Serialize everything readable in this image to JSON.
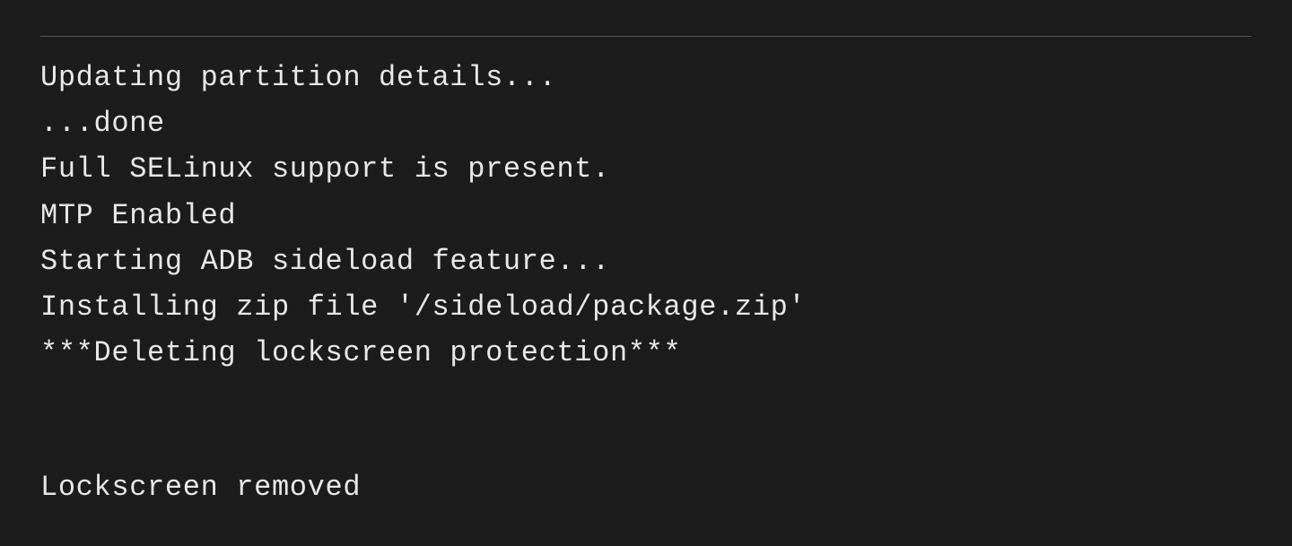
{
  "terminal": {
    "divider": true,
    "lines": [
      {
        "id": "line1",
        "text": "Updating partition details...",
        "empty": false
      },
      {
        "id": "line2",
        "text": "...done",
        "empty": false
      },
      {
        "id": "line3",
        "text": "Full SELinux support is present.",
        "empty": false
      },
      {
        "id": "line4",
        "text": "MTP Enabled",
        "empty": false
      },
      {
        "id": "line5",
        "text": "Starting ADB sideload feature...",
        "empty": false
      },
      {
        "id": "line6",
        "text": "Installing zip file '/sideload/package.zip'",
        "empty": false
      },
      {
        "id": "line7",
        "text": "***Deleting lockscreen protection***",
        "empty": false
      },
      {
        "id": "line8",
        "text": "",
        "empty": true
      },
      {
        "id": "line9",
        "text": "",
        "empty": true
      },
      {
        "id": "line10",
        "text": "Lockscreen removed",
        "empty": false
      }
    ]
  }
}
